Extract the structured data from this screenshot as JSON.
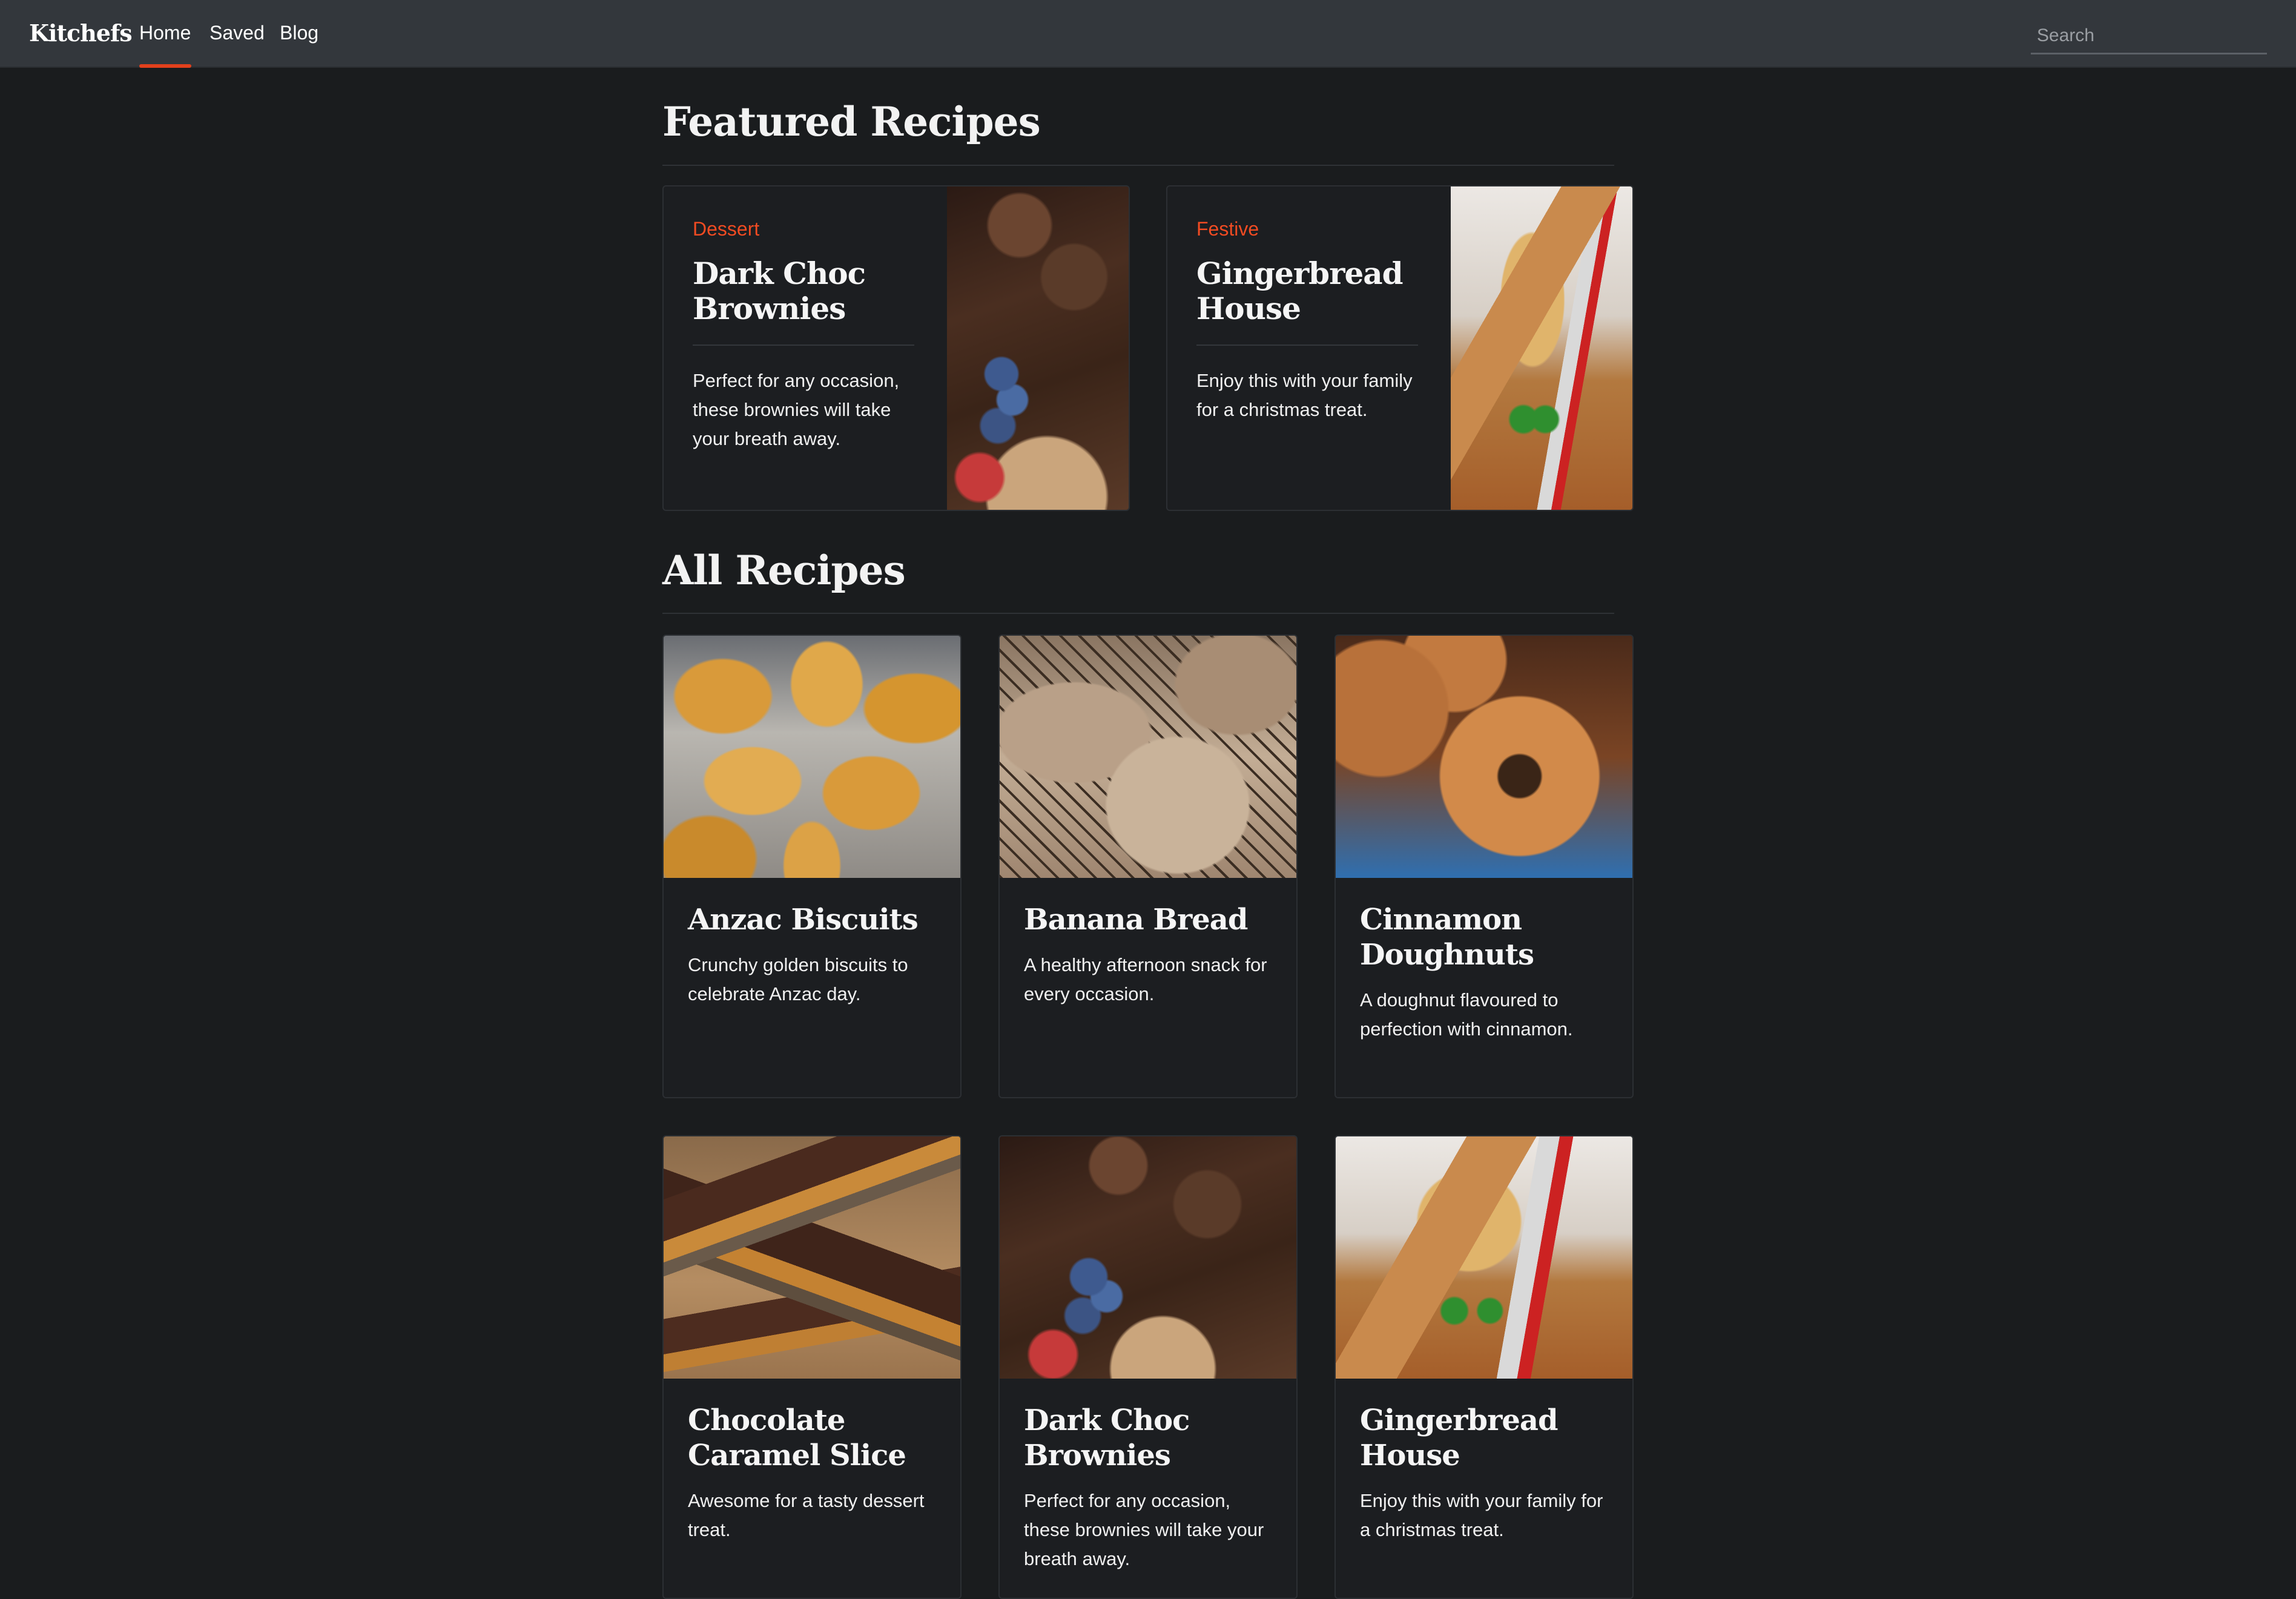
{
  "nav": {
    "brand": "Kitchefs",
    "links": [
      "Home",
      "Saved",
      "Blog"
    ],
    "active": "Home",
    "search_placeholder": "Search"
  },
  "colors": {
    "background": "#1a1c1e",
    "navbar": "#33373c",
    "accent": "#e2401c",
    "tag": "#f14b22"
  },
  "featured": {
    "title": "Featured Recipes",
    "cards": [
      {
        "tag": "Dessert",
        "title": "Dark Choc Brownies",
        "description": "Perfect for any occasion, these brownies will take your breath away.",
        "image": "brownies-photo"
      },
      {
        "tag": "Festive",
        "title": "Gingerbread House",
        "description": "Enjoy this with your family for a christmas treat.",
        "image": "gingerbread-house-photo"
      }
    ]
  },
  "all": {
    "title": "All Recipes",
    "cards": [
      {
        "title": "Anzac Biscuits",
        "description": "Crunchy golden biscuits to celebrate Anzac day.",
        "image": "anzac-biscuits-photo"
      },
      {
        "title": "Banana Bread",
        "description": "A healthy afternoon snack for every occasion.",
        "image": "banana-bread-photo"
      },
      {
        "title": "Cinnamon Doughnuts",
        "description": "A doughnut flavoured to perfection with cinnamon.",
        "image": "cinnamon-doughnuts-photo"
      },
      {
        "title": "Chocolate Caramel Slice",
        "description": "Awesome for a tasty dessert treat.",
        "image": "caramel-slice-photo"
      },
      {
        "title": "Dark Choc Brownies",
        "description": "Perfect for any occasion, these brownies will take your breath away.",
        "image": "brownies-photo"
      },
      {
        "title": "Gingerbread House",
        "description": "Enjoy this with your family for a christmas treat.",
        "image": "gingerbread-house-photo"
      }
    ]
  }
}
